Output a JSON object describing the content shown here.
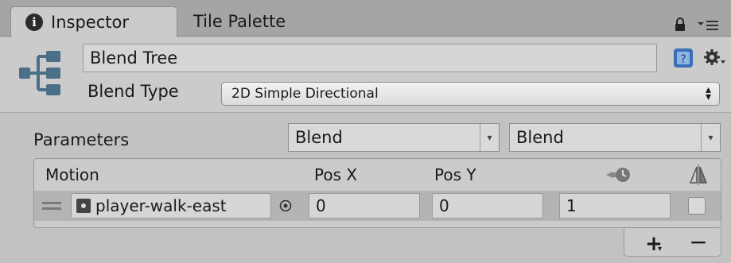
{
  "tabs": {
    "inspector": "Inspector",
    "tile_palette": "Tile Palette"
  },
  "header": {
    "name": "Blend Tree",
    "blend_type_label": "Blend Type",
    "blend_type_value": "2D Simple Directional"
  },
  "parameters": {
    "label": "Parameters",
    "x_param": "Blend",
    "y_param": "Blend"
  },
  "motion_table": {
    "headers": {
      "motion": "Motion",
      "pos_x": "Pos X",
      "pos_y": "Pos Y"
    },
    "rows": [
      {
        "clip": "player-walk-east",
        "pos_x": "0",
        "pos_y": "0",
        "speed": "1",
        "mirror": false
      }
    ]
  },
  "footer": {
    "add": "+",
    "remove": "−"
  },
  "icons": [
    "info-icon",
    "lock-icon",
    "menu-icon",
    "blend-tree-icon",
    "help-icon",
    "gear-icon",
    "speed-icon",
    "mirror-icon",
    "drag-handle-icon",
    "animation-clip-icon",
    "object-picker-icon"
  ],
  "colors": {
    "panel_bg": "#cbcbcb",
    "tabstrip_bg": "#a5a5a5",
    "help_blue": "#3a6fb5"
  }
}
